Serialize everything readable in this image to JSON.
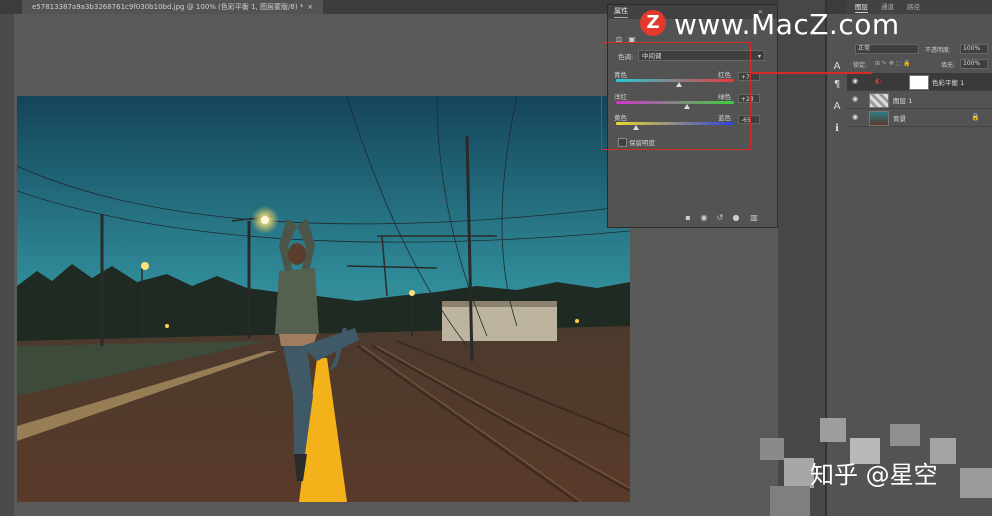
{
  "document_tab": {
    "title": "e57813387a9a3b3268761c9f030b10bd.jpg @ 100% (色彩平衡 1, 图层蒙版/8) *",
    "close": "×"
  },
  "watermarks": {
    "logo_letter": "Z",
    "site": "www.MacZ.com",
    "bottom": "知乎 @星空"
  },
  "properties": {
    "tab_label": "属性",
    "close_glyph": "»",
    "header_icons": [
      "balance-icon",
      "mask-icon"
    ],
    "tone_label": "色调:",
    "tone_value": "中间调",
    "sliders": [
      {
        "left": "青色",
        "right": "红色",
        "value": "+7",
        "fraction": 0.53
      },
      {
        "left": "洋红",
        "right": "绿色",
        "value": "+23",
        "fraction": 0.6
      },
      {
        "left": "黄色",
        "right": "蓝色",
        "value": "-65",
        "fraction": 0.17
      }
    ],
    "preserve_luminosity": "保留明度",
    "preserve_checked": false,
    "footer_icons": [
      "clip-icon",
      "view-previous-icon",
      "reset-icon",
      "visibility-icon",
      "trash-icon"
    ]
  },
  "layers_panel": {
    "tabs": [
      "图层",
      "通道",
      "路径"
    ],
    "blend_mode": "正常",
    "opacity_label": "不透明度:",
    "opacity_value": "100%",
    "lock_label": "锁定:",
    "fill_label": "填充:",
    "fill_value": "100%",
    "layers": [
      {
        "name": "色彩平衡 1",
        "selected": true
      },
      {
        "name": "图层 1",
        "selected": false
      },
      {
        "name": "背景",
        "selected": false
      }
    ],
    "lock_glyph": "🔒"
  },
  "tools": [
    "A",
    "¶",
    "A",
    "ℹ"
  ],
  "colors": {
    "highlight_red": "#d42a2a",
    "panel_bg": "#535353",
    "dark_bg": "#424242"
  }
}
